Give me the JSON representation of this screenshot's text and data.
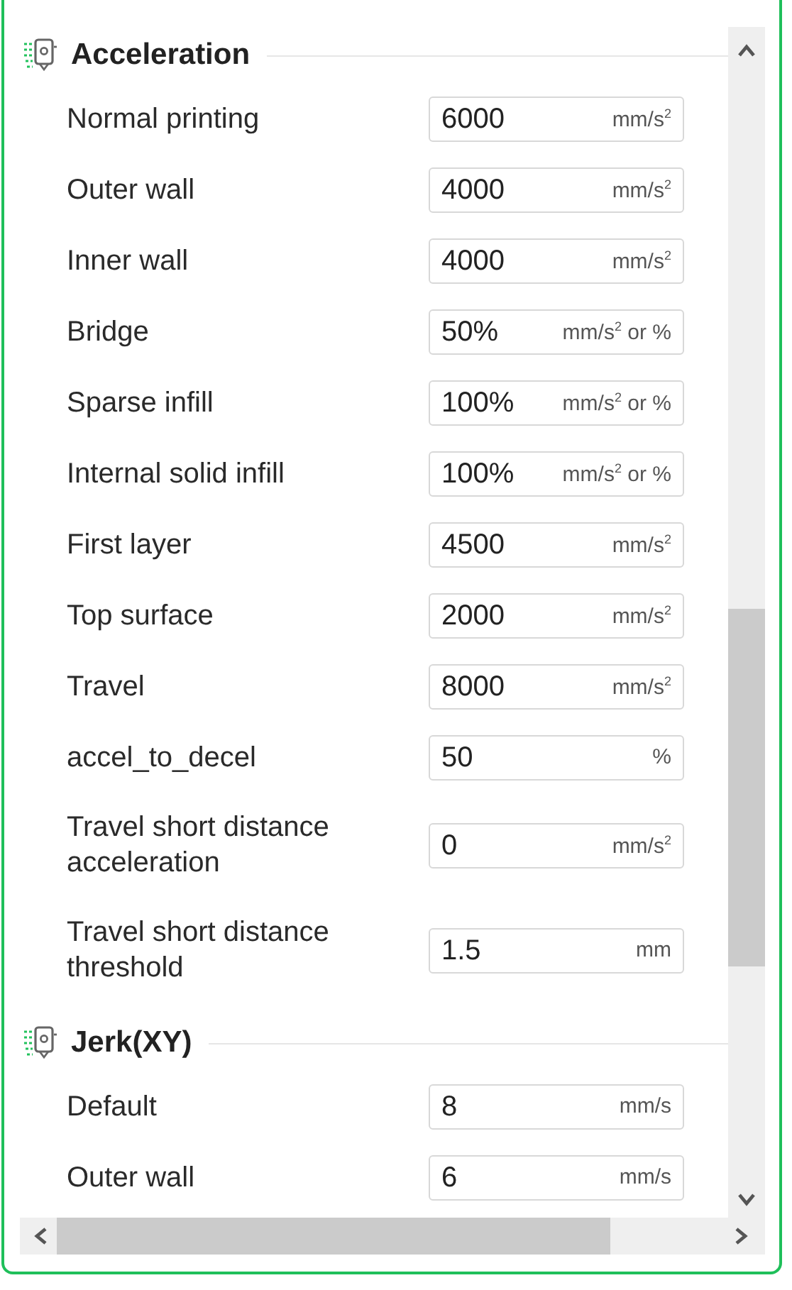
{
  "sections": [
    {
      "title": "Acceleration",
      "rows": [
        {
          "label": "Normal printing",
          "value": "6000",
          "unit": "mm/s$^{2}$"
        },
        {
          "label": "Outer wall",
          "value": "4000",
          "unit": "mm/s$^{2}$"
        },
        {
          "label": "Inner wall",
          "value": "4000",
          "unit": "mm/s$^{2}$"
        },
        {
          "label": "Bridge",
          "value": "50%",
          "unit": "mm/s$^{2}$ or %"
        },
        {
          "label": "Sparse infill",
          "value": "100%",
          "unit": "mm/s$^{2}$ or %"
        },
        {
          "label": "Internal solid infill",
          "value": "100%",
          "unit": "mm/s$^{2}$ or %"
        },
        {
          "label": "First layer",
          "value": "4500",
          "unit": "mm/s$^{2}$"
        },
        {
          "label": "Top surface",
          "value": "2000",
          "unit": "mm/s$^{2}$"
        },
        {
          "label": "Travel",
          "value": "8000",
          "unit": "mm/s$^{2}$"
        },
        {
          "label": "accel_to_decel",
          "value": "50",
          "unit": "%"
        },
        {
          "label": "Travel short distance acceleration",
          "value": "0",
          "unit": "mm/s$^{2}$"
        },
        {
          "label": "Travel short distance threshold",
          "value": "1.5",
          "unit": "mm"
        }
      ]
    },
    {
      "title": "Jerk(XY)",
      "rows": [
        {
          "label": "Default",
          "value": "8",
          "unit": "mm/s"
        },
        {
          "label": "Outer wall",
          "value": "6",
          "unit": "mm/s"
        }
      ]
    }
  ]
}
